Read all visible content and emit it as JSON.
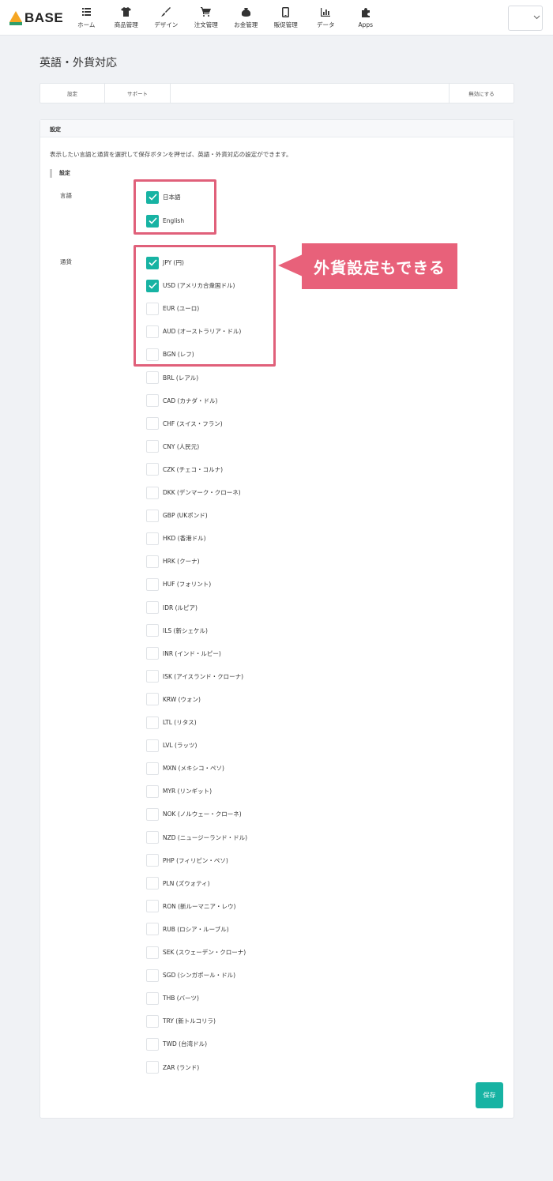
{
  "brand": {
    "name": "BASE",
    "accent": "#17b3a3",
    "highlight": "#e0607a"
  },
  "nav": [
    {
      "label": "ホーム",
      "icon": "list-icon"
    },
    {
      "label": "商品管理",
      "icon": "shirt-icon"
    },
    {
      "label": "デザイン",
      "icon": "brush-icon"
    },
    {
      "label": "注文管理",
      "icon": "cart-icon"
    },
    {
      "label": "お金管理",
      "icon": "money-bag-icon"
    },
    {
      "label": "販促管理",
      "icon": "phone-icon"
    },
    {
      "label": "データ",
      "icon": "bar-chart-icon"
    },
    {
      "label": "Apps",
      "icon": "puzzle-icon"
    }
  ],
  "account": {
    "icon": "chevron-down-icon"
  },
  "page": {
    "title": "英語・外貨対応"
  },
  "tabs": {
    "settings": "設定",
    "support": "サポート",
    "disable": "無効にする"
  },
  "panel": {
    "header": "設定",
    "description": "表示したい言語と通貨を選択して保存ボタンを押せば、英語・外貨対応の設定ができます。",
    "section": "設定",
    "language_label": "言語",
    "currency_label": "通貨"
  },
  "languages": [
    {
      "label": "日本語",
      "checked": true
    },
    {
      "label": "English",
      "checked": true
    }
  ],
  "currencies": [
    {
      "label": "JPY (円)",
      "checked": true
    },
    {
      "label": "USD (アメリカ合衆国ドル)",
      "checked": true
    },
    {
      "label": "EUR (ユーロ)",
      "checked": false
    },
    {
      "label": "AUD (オーストラリア・ドル)",
      "checked": false
    },
    {
      "label": "BGN (レフ)",
      "checked": false
    },
    {
      "label": "BRL (レアル)",
      "checked": false
    },
    {
      "label": "CAD (カナダ・ドル)",
      "checked": false
    },
    {
      "label": "CHF (スイス・フラン)",
      "checked": false
    },
    {
      "label": "CNY (人民元)",
      "checked": false
    },
    {
      "label": "CZK (チェコ・コルナ)",
      "checked": false
    },
    {
      "label": "DKK (デンマーク・クローネ)",
      "checked": false
    },
    {
      "label": "GBP (UKポンド)",
      "checked": false
    },
    {
      "label": "HKD (香港ドル)",
      "checked": false
    },
    {
      "label": "HRK (クーナ)",
      "checked": false
    },
    {
      "label": "HUF (フォリント)",
      "checked": false
    },
    {
      "label": "IDR (ルピア)",
      "checked": false
    },
    {
      "label": "ILS (新シェケル)",
      "checked": false
    },
    {
      "label": "INR (インド・ルピー)",
      "checked": false
    },
    {
      "label": "ISK (アイスランド・クローナ)",
      "checked": false
    },
    {
      "label": "KRW (ウォン)",
      "checked": false
    },
    {
      "label": "LTL (リタス)",
      "checked": false
    },
    {
      "label": "LVL (ラッツ)",
      "checked": false
    },
    {
      "label": "MXN (メキシコ・ペソ)",
      "checked": false
    },
    {
      "label": "MYR (リンギット)",
      "checked": false
    },
    {
      "label": "NOK (ノルウェー・クローネ)",
      "checked": false
    },
    {
      "label": "NZD (ニュージーランド・ドル)",
      "checked": false
    },
    {
      "label": "PHP (フィリピン・ペソ)",
      "checked": false
    },
    {
      "label": "PLN (ズウォティ)",
      "checked": false
    },
    {
      "label": "RON (新ルーマニア・レウ)",
      "checked": false
    },
    {
      "label": "RUB (ロシア・ルーブル)",
      "checked": false
    },
    {
      "label": "SEK (スウェーデン・クローナ)",
      "checked": false
    },
    {
      "label": "SGD (シンガポール・ドル)",
      "checked": false
    },
    {
      "label": "THB (バーツ)",
      "checked": false
    },
    {
      "label": "TRY (新トルコリラ)",
      "checked": false
    },
    {
      "label": "TWD (台湾ドル)",
      "checked": false
    },
    {
      "label": "ZAR (ランド)",
      "checked": false
    }
  ],
  "callout": {
    "text": "外貨設定もできる"
  },
  "save_label": "保存"
}
